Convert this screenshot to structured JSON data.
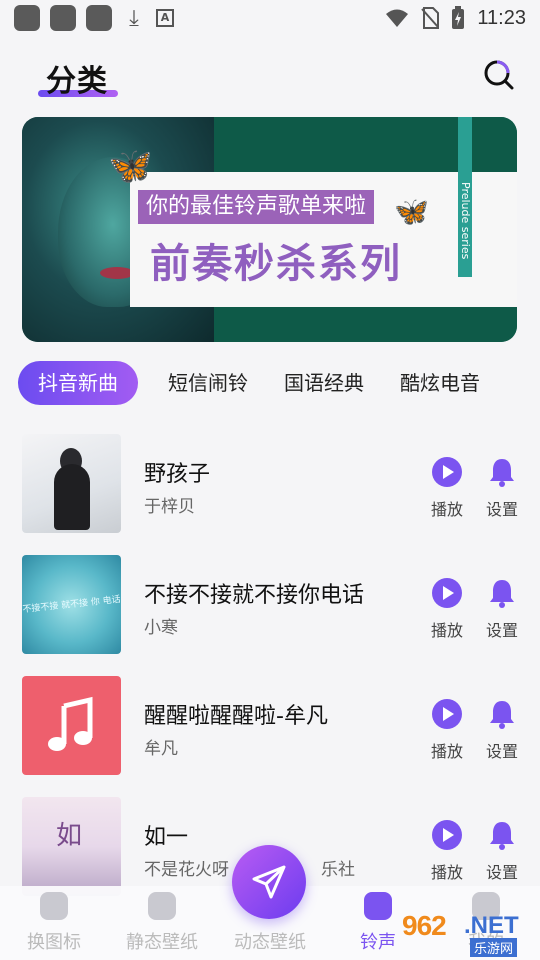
{
  "status_bar": {
    "time": "11:23"
  },
  "header": {
    "title": "分类",
    "search_icon": "search-icon"
  },
  "banner": {
    "tagline": "你的最佳铃声歌单来啦",
    "headline": "前奏秒杀系列",
    "side_text": "Prelude series"
  },
  "tabs": [
    {
      "label": "抖音新曲",
      "active": true
    },
    {
      "label": "短信闹铃",
      "active": false
    },
    {
      "label": "国语经典",
      "active": false
    },
    {
      "label": "酷炫电音",
      "active": false
    }
  ],
  "songs": [
    {
      "title": "野孩子",
      "artist": "于梓贝",
      "play_label": "播放",
      "set_label": "设置"
    },
    {
      "title": "不接不接就不接你电话",
      "artist": "小寒",
      "thumb_text": "不接不接 就不接 你 电话",
      "play_label": "播放",
      "set_label": "设置"
    },
    {
      "title": "醒醒啦醒醒啦-牟凡",
      "artist": "牟凡",
      "play_label": "播放",
      "set_label": "设置"
    },
    {
      "title": "如一",
      "artist": "不是花火呀",
      "artist_suffix": "乐社",
      "thumb_text": "如",
      "play_label": "播放",
      "set_label": "设置"
    }
  ],
  "bottom_nav": [
    {
      "label": "换图标",
      "active": false
    },
    {
      "label": "静态壁纸",
      "active": false
    },
    {
      "label": "动态壁纸",
      "active": false
    },
    {
      "label": "铃声",
      "active": true
    },
    {
      "label": "我的",
      "active": false
    }
  ],
  "watermark": {
    "number": "962",
    "domain": ".NET",
    "sub": "乐游网"
  },
  "colors": {
    "accent": "#7b54f0",
    "accent_light": "#a25cf2",
    "inactive_nav": "#bbbbbb"
  }
}
